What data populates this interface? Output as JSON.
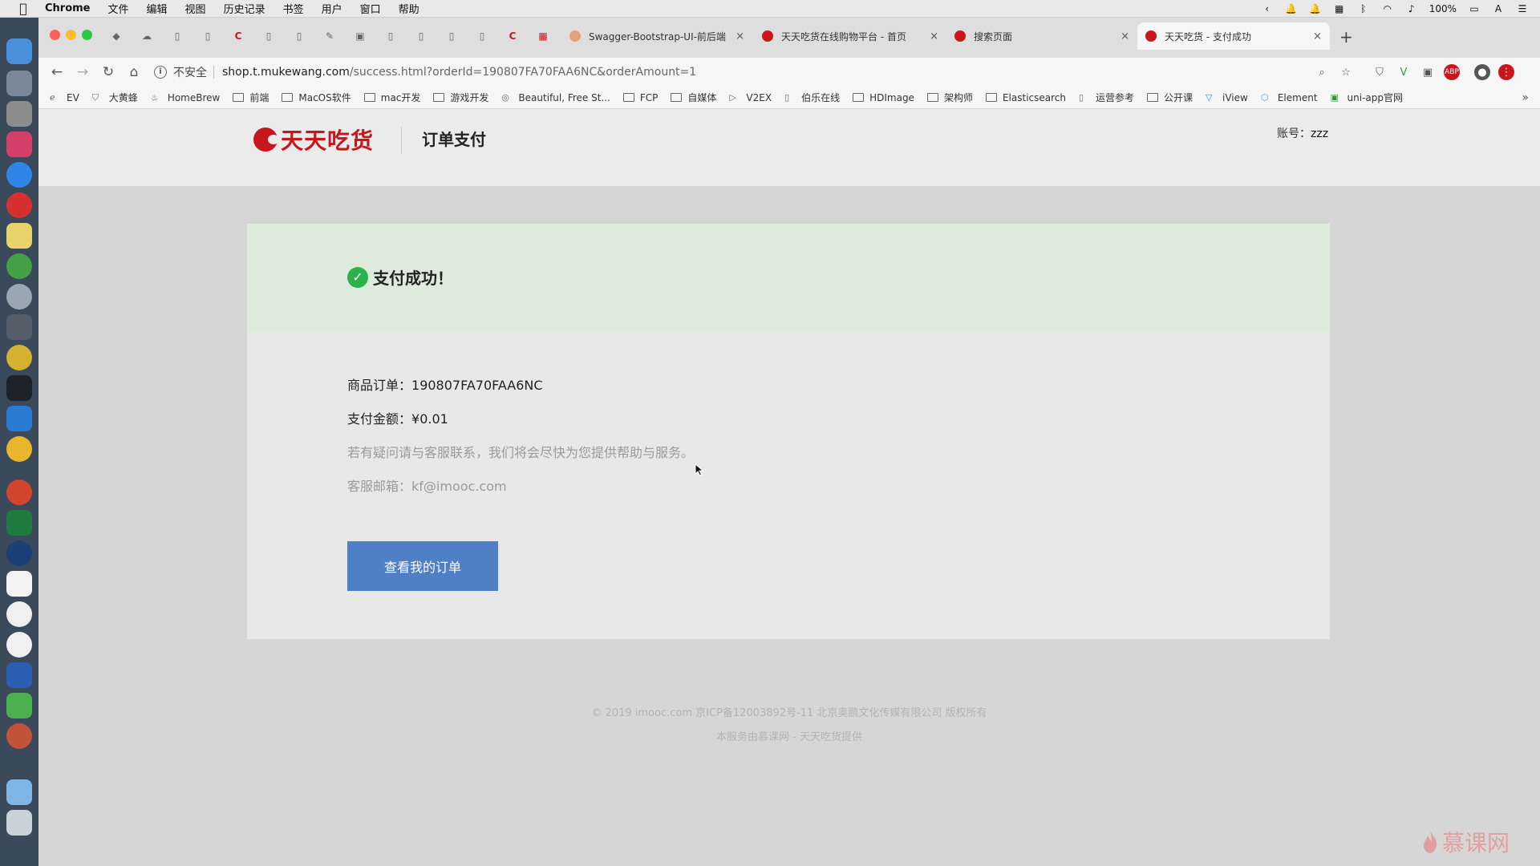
{
  "menubar": {
    "app": "Chrome",
    "items": [
      "文件",
      "编辑",
      "视图",
      "历史记录",
      "书签",
      "用户",
      "窗口",
      "帮助"
    ],
    "battery": "100%"
  },
  "tabs": [
    {
      "title": "Swagger-Bootstrap-UI-前后端",
      "close": "×"
    },
    {
      "title": "天天吃货在线购物平台 - 首页",
      "close": "×"
    },
    {
      "title": "搜索页面",
      "close": "×"
    },
    {
      "title": "天天吃货 - 支付成功",
      "close": "×"
    }
  ],
  "new_tab": "+",
  "address": {
    "security_label": "不安全",
    "host": "shop.t.mukewang.com",
    "path": "/success.html?orderId=190807FA70FAA6NC&orderAmount=1"
  },
  "bookmarks": [
    "EV",
    "大黄蜂",
    "HomeBrew",
    "前端",
    "MacOS软件",
    "mac开发",
    "游戏开发",
    "Beautiful, Free St...",
    "FCP",
    "自媒体",
    "V2EX",
    "伯乐在线",
    "HDImage",
    "架构师",
    "Elasticsearch",
    "运营参考",
    "公开课",
    "iView",
    "Element",
    "uni-app官网"
  ],
  "bookmarks_more": "»",
  "site": {
    "logo_text": "天天吃货",
    "page_title": "订单支付",
    "account_label": "账号：",
    "account_name": "zzz"
  },
  "payment": {
    "success_message": "支付成功！",
    "order_label": "商品订单：",
    "order_id": "190807FA70FAA6NC",
    "amount_label": "支付金额：",
    "amount": "¥0.01",
    "help_text": "若有疑问请与客服联系，我们将会尽快为您提供帮助与服务。",
    "email_label": "客服邮箱：",
    "email": "kf@imooc.com",
    "orders_button": "查看我的订单"
  },
  "footer": {
    "line1": "© 2019 imooc.com 京ICP备12003892号-11 北京奥鹏文化传媒有限公司 版权所有",
    "line2": "本服务由慕课网 - 天天吃货提供"
  },
  "watermark": "慕课网",
  "colors": {
    "brand_red": "#c8161d",
    "success_green": "#2bb24c",
    "button_blue": "#4f7fc4"
  }
}
